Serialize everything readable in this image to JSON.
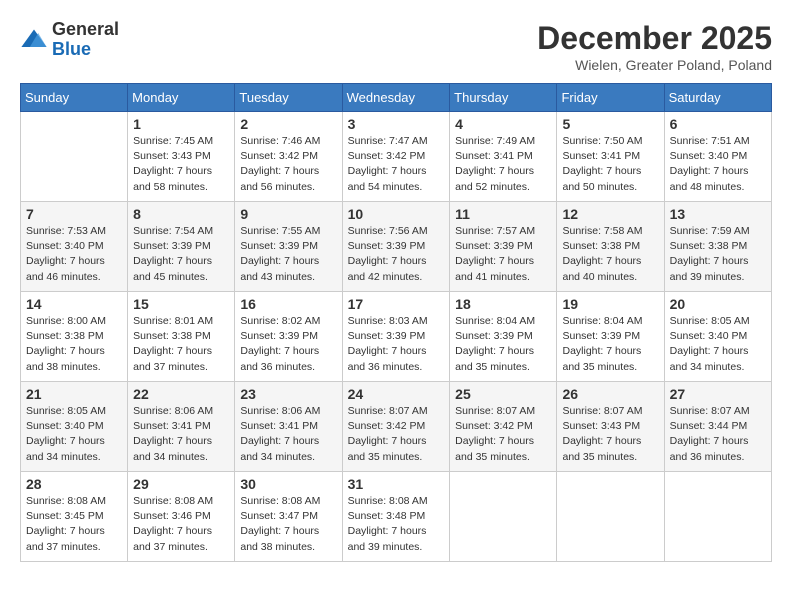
{
  "logo": {
    "general": "General",
    "blue": "Blue"
  },
  "header": {
    "month_title": "December 2025",
    "location": "Wielen, Greater Poland, Poland"
  },
  "days_of_week": [
    "Sunday",
    "Monday",
    "Tuesday",
    "Wednesday",
    "Thursday",
    "Friday",
    "Saturday"
  ],
  "weeks": [
    [
      {
        "day": "",
        "sunrise": "",
        "sunset": "",
        "daylight": ""
      },
      {
        "day": "1",
        "sunrise": "Sunrise: 7:45 AM",
        "sunset": "Sunset: 3:43 PM",
        "daylight": "Daylight: 7 hours and 58 minutes."
      },
      {
        "day": "2",
        "sunrise": "Sunrise: 7:46 AM",
        "sunset": "Sunset: 3:42 PM",
        "daylight": "Daylight: 7 hours and 56 minutes."
      },
      {
        "day": "3",
        "sunrise": "Sunrise: 7:47 AM",
        "sunset": "Sunset: 3:42 PM",
        "daylight": "Daylight: 7 hours and 54 minutes."
      },
      {
        "day": "4",
        "sunrise": "Sunrise: 7:49 AM",
        "sunset": "Sunset: 3:41 PM",
        "daylight": "Daylight: 7 hours and 52 minutes."
      },
      {
        "day": "5",
        "sunrise": "Sunrise: 7:50 AM",
        "sunset": "Sunset: 3:41 PM",
        "daylight": "Daylight: 7 hours and 50 minutes."
      },
      {
        "day": "6",
        "sunrise": "Sunrise: 7:51 AM",
        "sunset": "Sunset: 3:40 PM",
        "daylight": "Daylight: 7 hours and 48 minutes."
      }
    ],
    [
      {
        "day": "7",
        "sunrise": "Sunrise: 7:53 AM",
        "sunset": "Sunset: 3:40 PM",
        "daylight": "Daylight: 7 hours and 46 minutes."
      },
      {
        "day": "8",
        "sunrise": "Sunrise: 7:54 AM",
        "sunset": "Sunset: 3:39 PM",
        "daylight": "Daylight: 7 hours and 45 minutes."
      },
      {
        "day": "9",
        "sunrise": "Sunrise: 7:55 AM",
        "sunset": "Sunset: 3:39 PM",
        "daylight": "Daylight: 7 hours and 43 minutes."
      },
      {
        "day": "10",
        "sunrise": "Sunrise: 7:56 AM",
        "sunset": "Sunset: 3:39 PM",
        "daylight": "Daylight: 7 hours and 42 minutes."
      },
      {
        "day": "11",
        "sunrise": "Sunrise: 7:57 AM",
        "sunset": "Sunset: 3:39 PM",
        "daylight": "Daylight: 7 hours and 41 minutes."
      },
      {
        "day": "12",
        "sunrise": "Sunrise: 7:58 AM",
        "sunset": "Sunset: 3:38 PM",
        "daylight": "Daylight: 7 hours and 40 minutes."
      },
      {
        "day": "13",
        "sunrise": "Sunrise: 7:59 AM",
        "sunset": "Sunset: 3:38 PM",
        "daylight": "Daylight: 7 hours and 39 minutes."
      }
    ],
    [
      {
        "day": "14",
        "sunrise": "Sunrise: 8:00 AM",
        "sunset": "Sunset: 3:38 PM",
        "daylight": "Daylight: 7 hours and 38 minutes."
      },
      {
        "day": "15",
        "sunrise": "Sunrise: 8:01 AM",
        "sunset": "Sunset: 3:38 PM",
        "daylight": "Daylight: 7 hours and 37 minutes."
      },
      {
        "day": "16",
        "sunrise": "Sunrise: 8:02 AM",
        "sunset": "Sunset: 3:39 PM",
        "daylight": "Daylight: 7 hours and 36 minutes."
      },
      {
        "day": "17",
        "sunrise": "Sunrise: 8:03 AM",
        "sunset": "Sunset: 3:39 PM",
        "daylight": "Daylight: 7 hours and 36 minutes."
      },
      {
        "day": "18",
        "sunrise": "Sunrise: 8:04 AM",
        "sunset": "Sunset: 3:39 PM",
        "daylight": "Daylight: 7 hours and 35 minutes."
      },
      {
        "day": "19",
        "sunrise": "Sunrise: 8:04 AM",
        "sunset": "Sunset: 3:39 PM",
        "daylight": "Daylight: 7 hours and 35 minutes."
      },
      {
        "day": "20",
        "sunrise": "Sunrise: 8:05 AM",
        "sunset": "Sunset: 3:40 PM",
        "daylight": "Daylight: 7 hours and 34 minutes."
      }
    ],
    [
      {
        "day": "21",
        "sunrise": "Sunrise: 8:05 AM",
        "sunset": "Sunset: 3:40 PM",
        "daylight": "Daylight: 7 hours and 34 minutes."
      },
      {
        "day": "22",
        "sunrise": "Sunrise: 8:06 AM",
        "sunset": "Sunset: 3:41 PM",
        "daylight": "Daylight: 7 hours and 34 minutes."
      },
      {
        "day": "23",
        "sunrise": "Sunrise: 8:06 AM",
        "sunset": "Sunset: 3:41 PM",
        "daylight": "Daylight: 7 hours and 34 minutes."
      },
      {
        "day": "24",
        "sunrise": "Sunrise: 8:07 AM",
        "sunset": "Sunset: 3:42 PM",
        "daylight": "Daylight: 7 hours and 35 minutes."
      },
      {
        "day": "25",
        "sunrise": "Sunrise: 8:07 AM",
        "sunset": "Sunset: 3:42 PM",
        "daylight": "Daylight: 7 hours and 35 minutes."
      },
      {
        "day": "26",
        "sunrise": "Sunrise: 8:07 AM",
        "sunset": "Sunset: 3:43 PM",
        "daylight": "Daylight: 7 hours and 35 minutes."
      },
      {
        "day": "27",
        "sunrise": "Sunrise: 8:07 AM",
        "sunset": "Sunset: 3:44 PM",
        "daylight": "Daylight: 7 hours and 36 minutes."
      }
    ],
    [
      {
        "day": "28",
        "sunrise": "Sunrise: 8:08 AM",
        "sunset": "Sunset: 3:45 PM",
        "daylight": "Daylight: 7 hours and 37 minutes."
      },
      {
        "day": "29",
        "sunrise": "Sunrise: 8:08 AM",
        "sunset": "Sunset: 3:46 PM",
        "daylight": "Daylight: 7 hours and 37 minutes."
      },
      {
        "day": "30",
        "sunrise": "Sunrise: 8:08 AM",
        "sunset": "Sunset: 3:47 PM",
        "daylight": "Daylight: 7 hours and 38 minutes."
      },
      {
        "day": "31",
        "sunrise": "Sunrise: 8:08 AM",
        "sunset": "Sunset: 3:48 PM",
        "daylight": "Daylight: 7 hours and 39 minutes."
      },
      {
        "day": "",
        "sunrise": "",
        "sunset": "",
        "daylight": ""
      },
      {
        "day": "",
        "sunrise": "",
        "sunset": "",
        "daylight": ""
      },
      {
        "day": "",
        "sunrise": "",
        "sunset": "",
        "daylight": ""
      }
    ]
  ]
}
